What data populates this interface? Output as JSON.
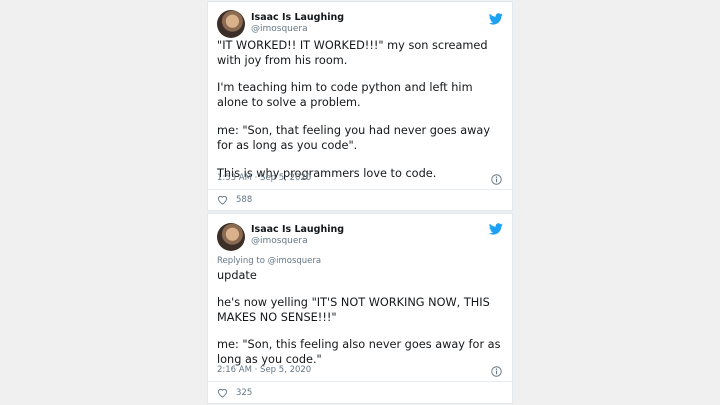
{
  "tweets": [
    {
      "author_name": "Isaac Is Laughing",
      "author_handle": "@imosquera",
      "lines": [
        "\"IT WORKED!! IT WORKED!!!\" my son screamed with joy from his room.",
        "I'm teaching him to code python and left him alone to solve a problem.",
        "me: \"Son, that feeling you had never goes away for as long as you code\".",
        "This is why programmers love to code."
      ],
      "timestamp": "1:53 AM · Sep 5, 2020",
      "likes": "588"
    },
    {
      "author_name": "Isaac Is Laughing",
      "author_handle": "@imosquera",
      "replying_to": "Replying to @imosquera",
      "lines": [
        "update",
        "he's now yelling \"IT'S NOT WORKING NOW, THIS MAKES NO SENSE!!!\"",
        "me: \"Son, this feeling also never goes away for as long as you code.\""
      ],
      "timestamp": "2:16 AM · Sep 5, 2020",
      "likes": "325"
    }
  ],
  "icons": {
    "brand": "twitter-bird-icon",
    "info": "info-icon",
    "like": "heart-icon"
  },
  "colors": {
    "twitter_blue": "#1da1f2",
    "secondary_text": "#657786",
    "primary_text": "#14171a"
  }
}
